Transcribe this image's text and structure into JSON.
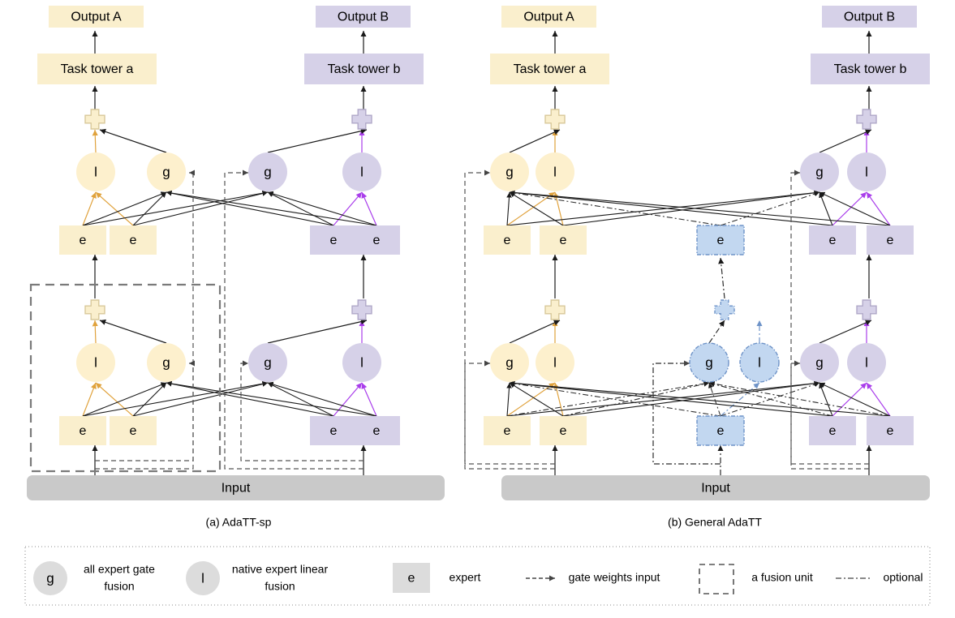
{
  "figure": {
    "title": "AdaTT architecture diagram",
    "panels": [
      {
        "id": "a",
        "caption": "(a) AdaTT-sp"
      },
      {
        "id": "b",
        "caption": "(b) General AdaTT"
      }
    ]
  },
  "colors": {
    "task_a_fill": "#FAEFCD",
    "task_a_stroke": "#E0A23C",
    "task_a_node_fill": "#FDF0CD",
    "task_b_fill": "#D6D1E8",
    "task_b_stroke": "#A93DEB",
    "shared_fill": "#C2D7F0",
    "shared_stroke": "#6E93C8",
    "input_fill": "#C9C9C9",
    "legend_shape_fill": "#DCDCDC",
    "arrow_black": "#1A1A1A",
    "dash_grey": "#555555",
    "fusion_box_stroke": "#7A7A7A"
  },
  "labels": {
    "output_a": "Output A",
    "output_b": "Output B",
    "tower_a": "Task tower a",
    "tower_b": "Task tower b",
    "input": "Input",
    "gate": "g",
    "linear": "l",
    "expert": "e",
    "plus": "+"
  },
  "panel_a": {
    "caption": "(a) AdaTT-sp",
    "outputs": [
      {
        "name": "output-a",
        "label": "Output A",
        "theme": "a"
      },
      {
        "name": "output-b",
        "label": "Output B",
        "theme": "b"
      }
    ],
    "towers": [
      {
        "name": "task-tower-a",
        "label": "Task tower a",
        "theme": "a"
      },
      {
        "name": "task-tower-b",
        "label": "Task tower b",
        "theme": "b"
      }
    ],
    "levels": [
      {
        "level": 2,
        "units": [
          {
            "theme": "a",
            "nodes": [
              {
                "type": "linear",
                "label": "l"
              },
              {
                "type": "gate",
                "label": "g"
              }
            ],
            "experts": [
              {
                "label": "e"
              },
              {
                "label": "e"
              }
            ]
          },
          {
            "theme": "b",
            "nodes": [
              {
                "type": "gate",
                "label": "g"
              },
              {
                "type": "linear",
                "label": "l"
              }
            ],
            "experts": [
              {
                "label": "e"
              },
              {
                "label": "e"
              }
            ]
          }
        ]
      },
      {
        "level": 1,
        "units": [
          {
            "theme": "a",
            "nodes": [
              {
                "type": "linear",
                "label": "l"
              },
              {
                "type": "gate",
                "label": "g"
              }
            ],
            "experts": [
              {
                "label": "e"
              },
              {
                "label": "e"
              }
            ],
            "fusion_unit_highlight": true
          },
          {
            "theme": "b",
            "nodes": [
              {
                "type": "gate",
                "label": "g"
              },
              {
                "type": "linear",
                "label": "l"
              }
            ],
            "experts": [
              {
                "label": "e"
              },
              {
                "label": "e"
              }
            ]
          }
        ]
      }
    ],
    "input_label": "Input"
  },
  "panel_b": {
    "caption": "(b) General AdaTT",
    "outputs": [
      {
        "name": "output-a",
        "label": "Output A",
        "theme": "a"
      },
      {
        "name": "output-b",
        "label": "Output B",
        "theme": "b"
      }
    ],
    "towers": [
      {
        "name": "task-tower-a",
        "label": "Task tower a",
        "theme": "a"
      },
      {
        "name": "task-tower-b",
        "label": "Task tower b",
        "theme": "b"
      }
    ],
    "levels": [
      {
        "level": 2,
        "units": [
          {
            "theme": "a",
            "nodes": [
              {
                "type": "gate",
                "label": "g"
              },
              {
                "type": "linear",
                "label": "l"
              }
            ],
            "experts": [
              {
                "label": "e"
              },
              {
                "label": "e"
              }
            ]
          },
          {
            "theme": "shared",
            "optional": true,
            "nodes": [],
            "experts": [
              {
                "label": "e"
              }
            ]
          },
          {
            "theme": "b",
            "nodes": [
              {
                "type": "gate",
                "label": "g"
              },
              {
                "type": "linear",
                "label": "l"
              }
            ],
            "experts": [
              {
                "label": "e"
              },
              {
                "label": "e"
              }
            ]
          }
        ]
      },
      {
        "level": 1,
        "units": [
          {
            "theme": "a",
            "nodes": [
              {
                "type": "gate",
                "label": "g"
              },
              {
                "type": "linear",
                "label": "l"
              }
            ],
            "experts": [
              {
                "label": "e"
              },
              {
                "label": "e"
              }
            ]
          },
          {
            "theme": "shared",
            "optional": true,
            "nodes": [
              {
                "type": "gate",
                "label": "g"
              },
              {
                "type": "linear",
                "label": "l"
              }
            ],
            "experts": [
              {
                "label": "e"
              }
            ]
          },
          {
            "theme": "b",
            "nodes": [
              {
                "type": "gate",
                "label": "g"
              },
              {
                "type": "linear",
                "label": "l"
              }
            ],
            "experts": [
              {
                "label": "e"
              },
              {
                "label": "e"
              }
            ]
          }
        ]
      }
    ],
    "input_label": "Input"
  },
  "legend": {
    "items": [
      {
        "id": "gate",
        "shape": "circle",
        "glyph": "g",
        "text_lines": [
          "all expert gate",
          "fusion"
        ]
      },
      {
        "id": "linear",
        "shape": "circle",
        "glyph": "l",
        "text_lines": [
          "native expert linear",
          "fusion"
        ]
      },
      {
        "id": "expert",
        "shape": "square",
        "glyph": "e",
        "text_lines": [
          "expert"
        ]
      },
      {
        "id": "gate-weights-input",
        "shape": "dashed-arrow",
        "glyph": "",
        "text_lines": [
          "gate weights input"
        ]
      },
      {
        "id": "fusion-unit",
        "shape": "dashed-box",
        "glyph": "",
        "text_lines": [
          "a fusion unit"
        ]
      },
      {
        "id": "optional",
        "shape": "dashdot-line",
        "glyph": "",
        "text_lines": [
          "optional"
        ]
      }
    ]
  }
}
